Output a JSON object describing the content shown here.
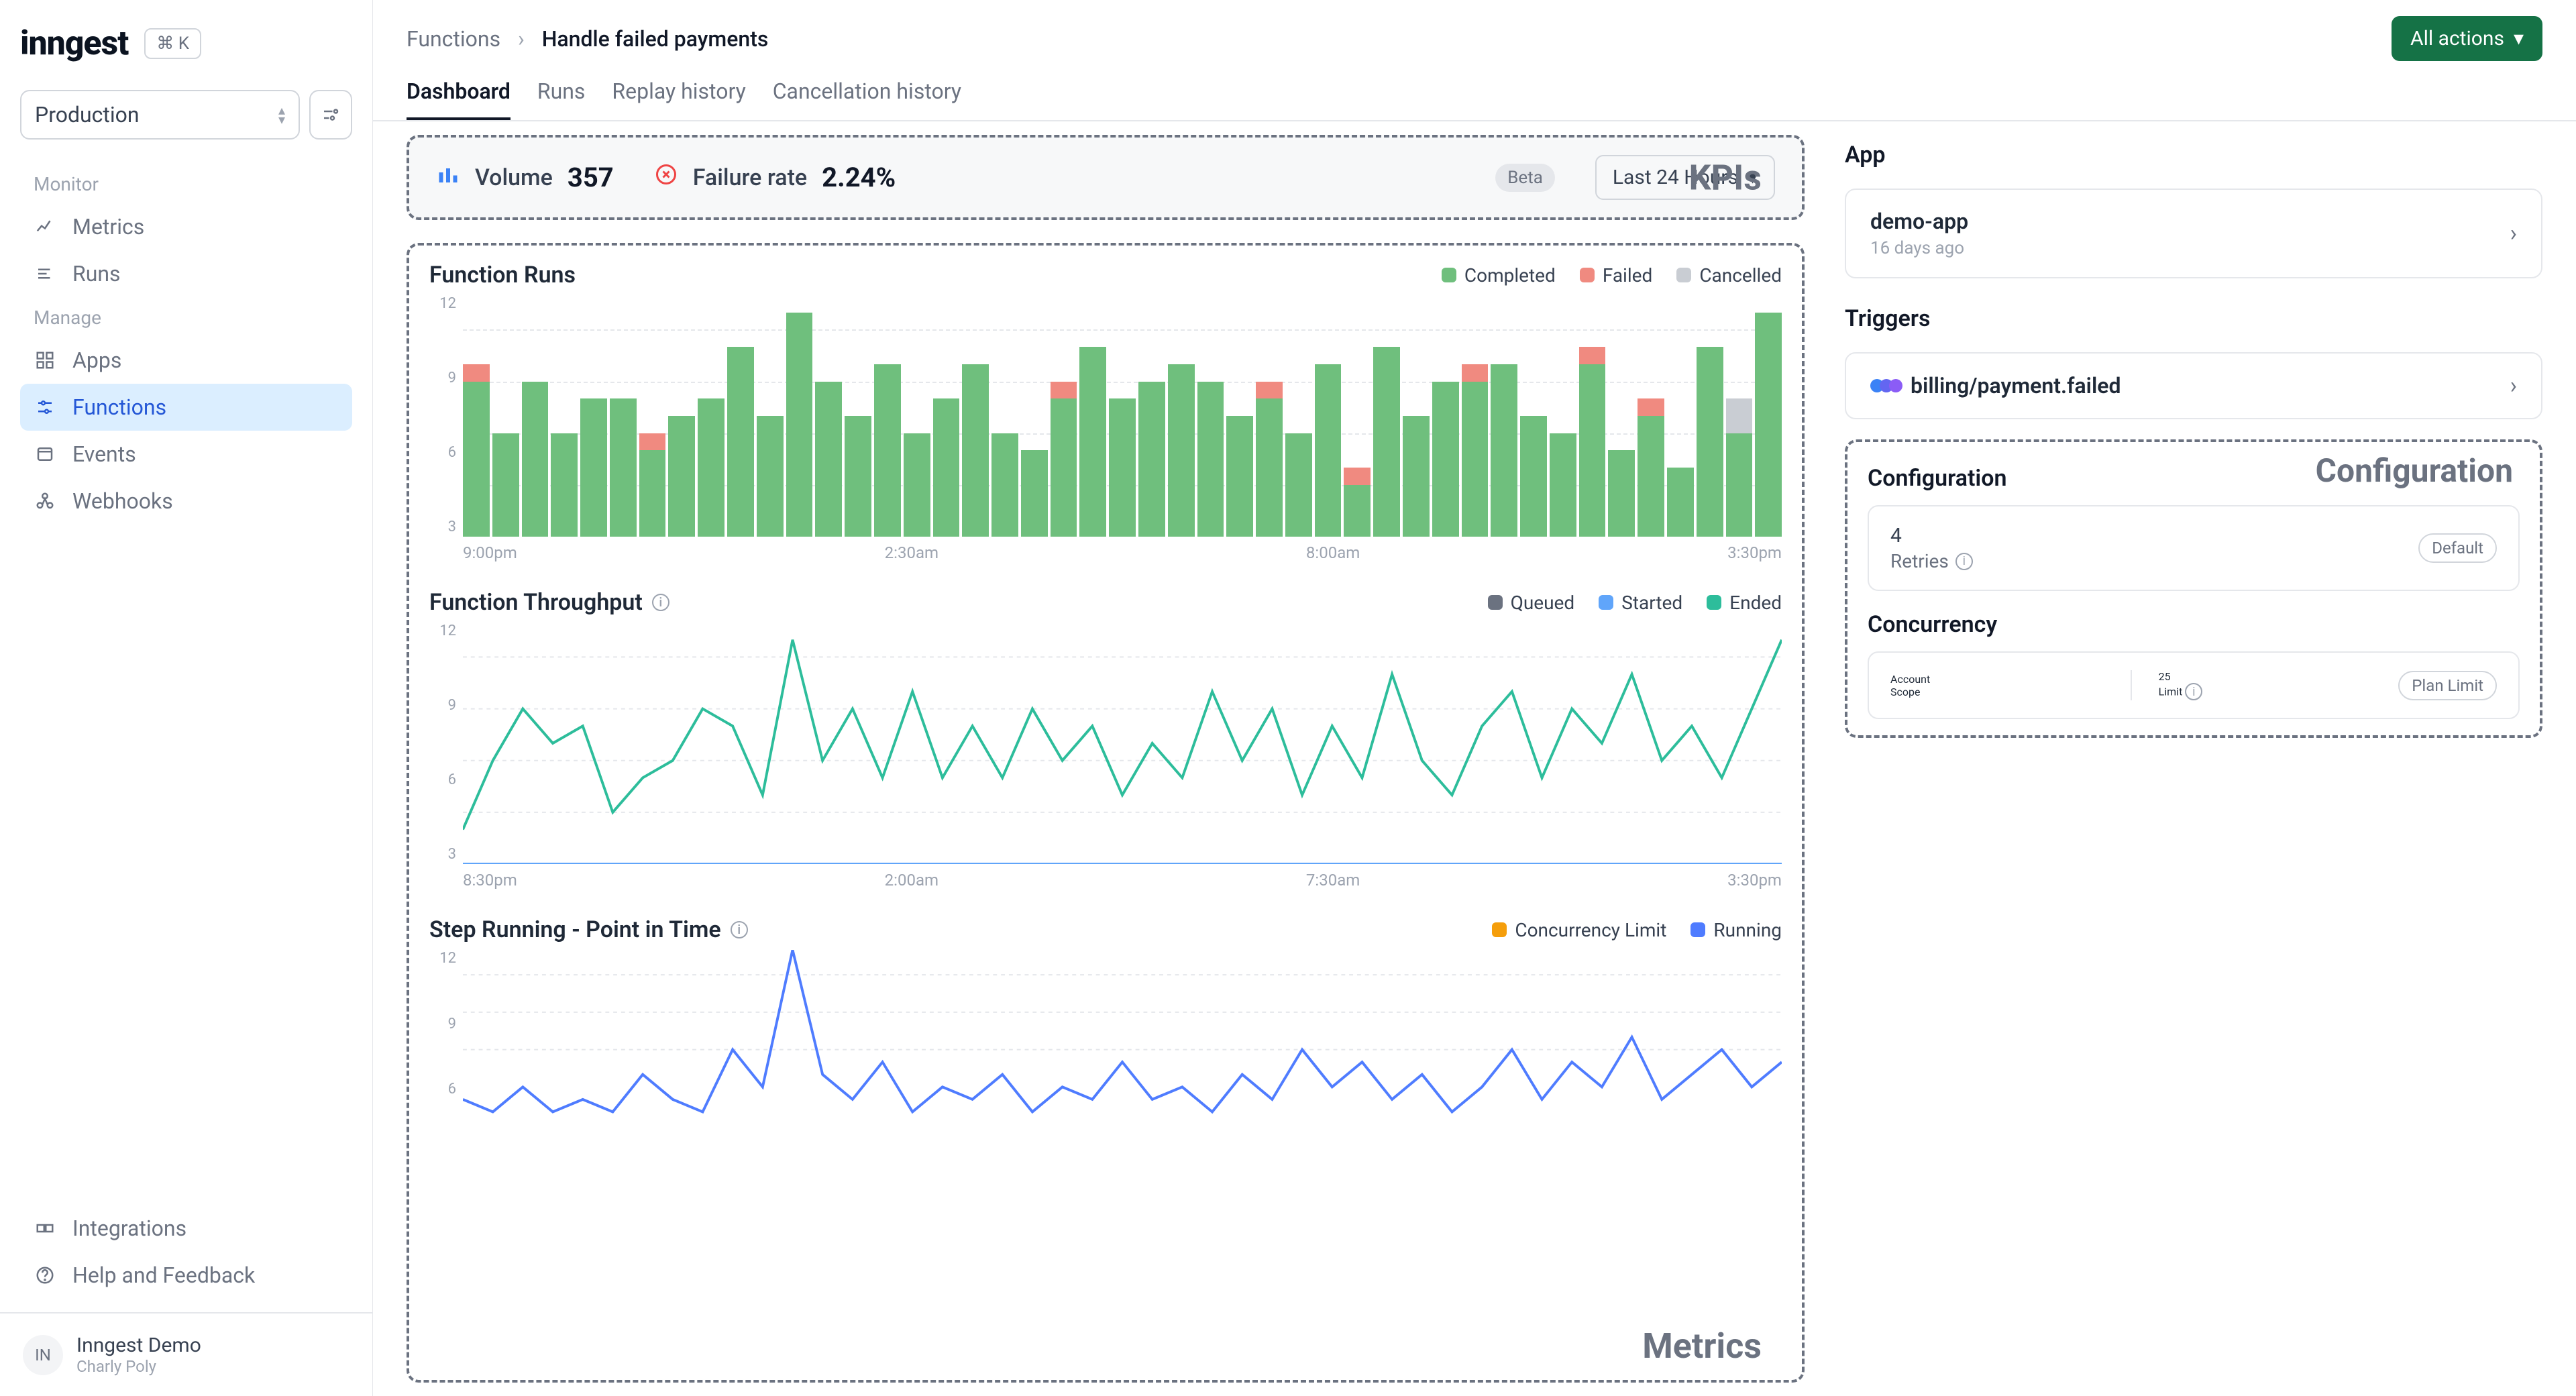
{
  "sidebar": {
    "logo": "inngest",
    "kbd": "⌘ K",
    "env": "Production",
    "groups": [
      {
        "label": "Monitor",
        "items": [
          {
            "name": "metrics",
            "label": "Metrics",
            "active": false
          },
          {
            "name": "runs",
            "label": "Runs",
            "active": false
          }
        ]
      },
      {
        "label": "Manage",
        "items": [
          {
            "name": "apps",
            "label": "Apps",
            "active": false
          },
          {
            "name": "functions",
            "label": "Functions",
            "active": true
          },
          {
            "name": "events",
            "label": "Events",
            "active": false
          },
          {
            "name": "webhooks",
            "label": "Webhooks",
            "active": false
          }
        ]
      }
    ],
    "bottom": [
      {
        "name": "integrations",
        "label": "Integrations"
      },
      {
        "name": "help",
        "label": "Help and Feedback"
      }
    ],
    "user": {
      "initials": "IN",
      "name": "Inngest Demo",
      "sub": "Charly Poly"
    }
  },
  "breadcrumb": {
    "root": "Functions",
    "current": "Handle failed payments"
  },
  "actions_button": "All actions",
  "tabs": [
    "Dashboard",
    "Runs",
    "Replay history",
    "Cancellation history"
  ],
  "active_tab": 0,
  "kpis": {
    "volume_label": "Volume",
    "volume_value": "357",
    "failure_label": "Failure rate",
    "failure_value": "2.24%",
    "beta": "Beta",
    "timerange": "Last 24 Hours"
  },
  "annotations": {
    "kpis": "KPIs",
    "metrics": "Metrics",
    "config": "Configuration"
  },
  "right": {
    "app_title": "App",
    "app": {
      "name": "demo-app",
      "age": "16 days ago"
    },
    "triggers_title": "Triggers",
    "trigger": "billing/payment.failed",
    "config_title": "Configuration",
    "retries": {
      "value": "4",
      "label": "Retries",
      "badge": "Default"
    },
    "concurrency_title": "Concurrency",
    "concurrency": {
      "scope_val": "Account",
      "scope_lab": "Scope",
      "limit_val": "25",
      "limit_lab": "Limit",
      "badge": "Plan Limit"
    }
  },
  "colors": {
    "completed": "#6fbf7d",
    "failed": "#f08a80",
    "cancelled": "#c9cdd3",
    "queued": "#6b7280",
    "started": "#60a5fa",
    "ended": "#2dbd9b",
    "conc_limit": "#f59e0b",
    "running": "#4f7cff"
  },
  "chart_data": [
    {
      "type": "bar",
      "title": "Function Runs",
      "ylabel": "",
      "xlabel": "",
      "ylim": [
        0,
        14
      ],
      "y_ticks": [
        3,
        6,
        9,
        12
      ],
      "x_ticks": [
        "9:00pm",
        "2:30am",
        "8:00am",
        "3:30pm"
      ],
      "series_names": [
        "Completed",
        "Failed",
        "Cancelled"
      ],
      "stacked": [
        {
          "completed": 9,
          "failed": 1,
          "cancelled": 0
        },
        {
          "completed": 6,
          "failed": 0,
          "cancelled": 0
        },
        {
          "completed": 9,
          "failed": 0,
          "cancelled": 0
        },
        {
          "completed": 6,
          "failed": 0,
          "cancelled": 0
        },
        {
          "completed": 8,
          "failed": 0,
          "cancelled": 0
        },
        {
          "completed": 8,
          "failed": 0,
          "cancelled": 0
        },
        {
          "completed": 5,
          "failed": 1,
          "cancelled": 0
        },
        {
          "completed": 7,
          "failed": 0,
          "cancelled": 0
        },
        {
          "completed": 8,
          "failed": 0,
          "cancelled": 0
        },
        {
          "completed": 11,
          "failed": 0,
          "cancelled": 0
        },
        {
          "completed": 7,
          "failed": 0,
          "cancelled": 0
        },
        {
          "completed": 13,
          "failed": 0,
          "cancelled": 0
        },
        {
          "completed": 9,
          "failed": 0,
          "cancelled": 0
        },
        {
          "completed": 7,
          "failed": 0,
          "cancelled": 0
        },
        {
          "completed": 10,
          "failed": 0,
          "cancelled": 0
        },
        {
          "completed": 6,
          "failed": 0,
          "cancelled": 0
        },
        {
          "completed": 8,
          "failed": 0,
          "cancelled": 0
        },
        {
          "completed": 10,
          "failed": 0,
          "cancelled": 0
        },
        {
          "completed": 6,
          "failed": 0,
          "cancelled": 0
        },
        {
          "completed": 5,
          "failed": 0,
          "cancelled": 0
        },
        {
          "completed": 8,
          "failed": 1,
          "cancelled": 0
        },
        {
          "completed": 11,
          "failed": 0,
          "cancelled": 0
        },
        {
          "completed": 8,
          "failed": 0,
          "cancelled": 0
        },
        {
          "completed": 9,
          "failed": 0,
          "cancelled": 0
        },
        {
          "completed": 10,
          "failed": 0,
          "cancelled": 0
        },
        {
          "completed": 9,
          "failed": 0,
          "cancelled": 0
        },
        {
          "completed": 7,
          "failed": 0,
          "cancelled": 0
        },
        {
          "completed": 8,
          "failed": 1,
          "cancelled": 0
        },
        {
          "completed": 6,
          "failed": 0,
          "cancelled": 0
        },
        {
          "completed": 10,
          "failed": 0,
          "cancelled": 0
        },
        {
          "completed": 3,
          "failed": 1,
          "cancelled": 0
        },
        {
          "completed": 11,
          "failed": 0,
          "cancelled": 0
        },
        {
          "completed": 7,
          "failed": 0,
          "cancelled": 0
        },
        {
          "completed": 9,
          "failed": 0,
          "cancelled": 0
        },
        {
          "completed": 9,
          "failed": 1,
          "cancelled": 0
        },
        {
          "completed": 10,
          "failed": 0,
          "cancelled": 0
        },
        {
          "completed": 7,
          "failed": 0,
          "cancelled": 0
        },
        {
          "completed": 6,
          "failed": 0,
          "cancelled": 0
        },
        {
          "completed": 10,
          "failed": 1,
          "cancelled": 0
        },
        {
          "completed": 5,
          "failed": 0,
          "cancelled": 0
        },
        {
          "completed": 7,
          "failed": 1,
          "cancelled": 0
        },
        {
          "completed": 4,
          "failed": 0,
          "cancelled": 0
        },
        {
          "completed": 11,
          "failed": 0,
          "cancelled": 0
        },
        {
          "completed": 6,
          "failed": 0,
          "cancelled": 2
        },
        {
          "completed": 13,
          "failed": 0,
          "cancelled": 0
        }
      ]
    },
    {
      "type": "line",
      "title": "Function Throughput",
      "ylim": [
        0,
        14
      ],
      "y_ticks": [
        3,
        6,
        9,
        12
      ],
      "x_ticks": [
        "8:30pm",
        "2:00am",
        "7:30am",
        "3:30pm"
      ],
      "series": [
        {
          "name": "Queued",
          "color": "queued",
          "values": [
            0,
            0,
            0,
            0,
            0,
            0,
            0,
            0,
            0,
            0,
            0,
            0,
            0,
            0,
            0,
            0,
            0,
            0,
            0,
            0,
            0,
            0,
            0,
            0,
            0,
            0,
            0,
            0,
            0,
            0,
            0,
            0,
            0,
            0,
            0,
            0,
            0,
            0,
            0,
            0,
            0,
            0,
            0,
            0,
            0
          ]
        },
        {
          "name": "Started",
          "color": "started",
          "values": [
            0,
            0,
            0,
            0,
            0,
            0,
            0,
            0,
            0,
            0,
            0,
            0,
            0,
            0,
            0,
            0,
            0,
            0,
            0,
            0,
            0,
            0,
            0,
            0,
            0,
            0,
            0,
            0,
            0,
            0,
            0,
            0,
            0,
            0,
            0,
            0,
            0,
            0,
            0,
            0,
            0,
            0,
            0,
            0,
            0
          ]
        },
        {
          "name": "Ended",
          "color": "ended",
          "values": [
            2,
            6,
            9,
            7,
            8,
            3,
            5,
            6,
            9,
            8,
            4,
            13,
            6,
            9,
            5,
            10,
            5,
            8,
            5,
            9,
            6,
            8,
            4,
            7,
            5,
            10,
            6,
            9,
            4,
            8,
            5,
            11,
            6,
            4,
            8,
            10,
            5,
            9,
            7,
            11,
            6,
            8,
            5,
            9,
            13
          ]
        }
      ]
    },
    {
      "type": "line",
      "title": "Step Running - Point in Time",
      "ylim": [
        0,
        14
      ],
      "y_ticks": [
        6,
        9,
        12
      ],
      "x_ticks": [],
      "series": [
        {
          "name": "Concurrency Limit",
          "color": "conc_limit",
          "values": []
        },
        {
          "name": "Running",
          "color": "running",
          "values": [
            2,
            1,
            3,
            1,
            2,
            1,
            4,
            2,
            1,
            6,
            3,
            14,
            4,
            2,
            5,
            1,
            3,
            2,
            4,
            1,
            3,
            2,
            5,
            2,
            3,
            1,
            4,
            2,
            6,
            3,
            5,
            2,
            4,
            1,
            3,
            6,
            2,
            5,
            3,
            7,
            2,
            4,
            6,
            3,
            5
          ]
        }
      ]
    }
  ]
}
